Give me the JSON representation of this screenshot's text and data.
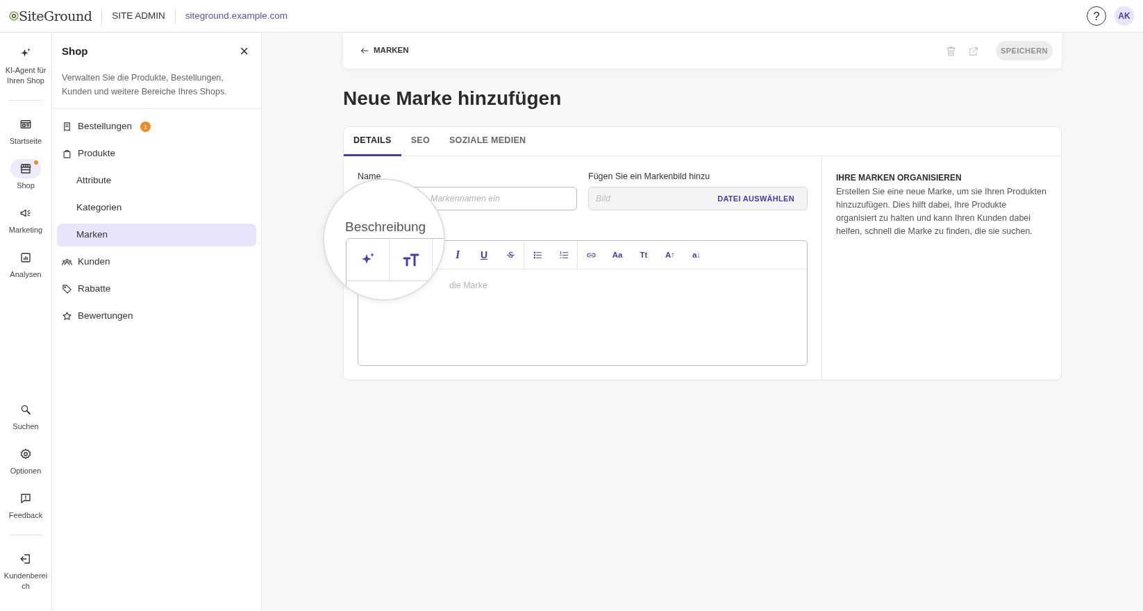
{
  "topbar": {
    "logo": "SiteGround",
    "section": "SITE ADMIN",
    "domain": "siteground.example.com",
    "help": "?",
    "avatar": "AK"
  },
  "rail": {
    "top": [
      {
        "kind": "sparkle",
        "label": "KI-Agent für Ihren Shop",
        "selected": false,
        "notify": false
      },
      {
        "kind": "home",
        "label": "Startseite",
        "selected": false,
        "notify": false
      },
      {
        "kind": "store",
        "label": "Shop",
        "selected": true,
        "notify": true
      },
      {
        "kind": "megaphone",
        "label": "Marketing",
        "selected": false,
        "notify": false
      },
      {
        "kind": "chart",
        "label": "Analysen",
        "selected": false,
        "notify": false
      }
    ],
    "bottom": [
      {
        "kind": "search",
        "label": "Suchen",
        "selected": false,
        "notify": false
      },
      {
        "kind": "gear",
        "label": "Optionen",
        "selected": false,
        "notify": false
      },
      {
        "kind": "feedback",
        "label": "Feedback",
        "selected": false,
        "notify": false
      },
      {
        "kind": "exit",
        "label": "Kundenbereich",
        "selected": false,
        "notify": false
      }
    ]
  },
  "panel": {
    "title": "Shop",
    "close": "×",
    "description": "Verwalten Sie die Produkte, Bestellungen, Kunden und weitere Bereiche Ihres Shops.",
    "items": [
      {
        "kind": "receipt",
        "label": "Bestellungen",
        "badge": "1",
        "selected": false
      },
      {
        "kind": "bag",
        "label": "Produkte",
        "selected": false,
        "children": [
          {
            "label": "Attribute",
            "selected": false
          },
          {
            "label": "Kategorien",
            "selected": false
          },
          {
            "label": "Marken",
            "selected": true
          }
        ]
      },
      {
        "kind": "people",
        "label": "Kunden",
        "selected": false
      },
      {
        "kind": "tag",
        "label": "Rabatte",
        "selected": false
      },
      {
        "kind": "star",
        "label": "Bewertungen",
        "selected": false
      }
    ]
  },
  "header": {
    "back": "MARKEN",
    "save": {
      "label": "SPEICHERN",
      "disabled": true
    }
  },
  "title": "Neue Marke hinzufügen",
  "tabs": [
    {
      "label": "DETAILS",
      "selected": true
    },
    {
      "label": "SEO",
      "selected": false
    },
    {
      "label": "SOZIALE MEDIEN",
      "selected": false
    }
  ],
  "form": {
    "name_label": "Name",
    "name_placeholder": "Markennamen ein",
    "image_label": "Fügen Sie ein Markenbild hinzu",
    "image_placeholder": "Bild",
    "file_button": "DATEI AUSWÄHLEN",
    "editor_placeholder": "die Marke",
    "toolbar": [
      {
        "kind": "italic",
        "label": "I"
      },
      {
        "kind": "underline",
        "label": "U"
      },
      {
        "kind": "strike"
      },
      {
        "kind": "separator"
      },
      {
        "kind": "bullets"
      },
      {
        "kind": "numbers"
      },
      {
        "kind": "separator"
      },
      {
        "kind": "link"
      },
      {
        "kind": "glyph",
        "label": "Aa"
      },
      {
        "kind": "glyph",
        "label": "Tt"
      },
      {
        "kind": "glyph",
        "label": "A↑"
      },
      {
        "kind": "glyph",
        "label": "a↓"
      }
    ]
  },
  "magnifier": {
    "label": "Beschreibung"
  },
  "info": {
    "heading": "IHRE MARKEN ORGANISIEREN",
    "text": "Erstellen Sie eine neue Marke, um sie Ihren Produkten hinzuzufügen. Dies hilft dabei, Ihre Produkte organisiert zu halten und kann Ihren Kunden dabei helfen, schnell die Marke zu finden, die sie suchen."
  }
}
